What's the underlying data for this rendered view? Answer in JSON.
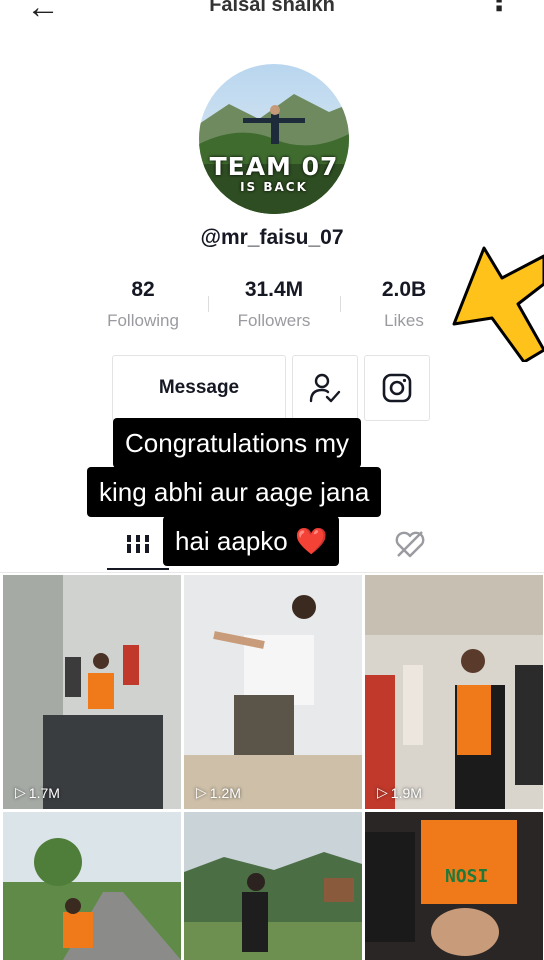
{
  "header": {
    "title": "Faisal shaikh",
    "back_icon": "arrow-left-icon",
    "more_icon": "more-vertical-icon"
  },
  "profile": {
    "avatar_lines": [
      "TEAM 07",
      "IS BACK"
    ],
    "username": "@mr_faisu_07",
    "stats": [
      {
        "value": "82",
        "label": "Following"
      },
      {
        "value": "31.4M",
        "label": "Followers"
      },
      {
        "value": "2.0B",
        "label": "Likes"
      }
    ]
  },
  "actions": {
    "message_label": "Message",
    "follow_icon": "user-check-icon",
    "instagram_icon": "instagram-icon"
  },
  "caption": {
    "lines": [
      "Congratulations my",
      "king abhi aur aage jana",
      "hai aapko ❤️"
    ]
  },
  "tabs": [
    {
      "icon": "grid-bars-icon",
      "active": true
    },
    {
      "icon": "liked-heart-icon",
      "active": false
    }
  ],
  "videos": [
    {
      "views": "1.7M"
    },
    {
      "views": "1.2M"
    },
    {
      "views": "1.9M"
    },
    {
      "views": ""
    },
    {
      "views": ""
    },
    {
      "views": ""
    }
  ],
  "colors": {
    "accent_arrow": "#ffc21a",
    "caption_bg": "#000000",
    "muted_text": "#9a9ba0"
  }
}
